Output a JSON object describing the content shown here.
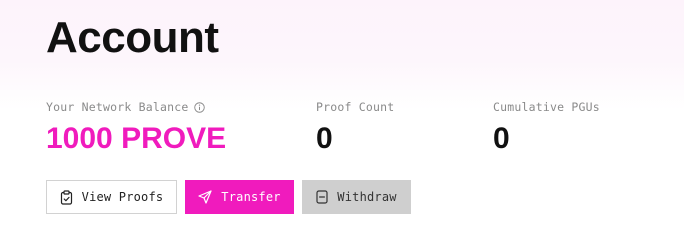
{
  "header": {
    "title": "Account"
  },
  "stats": {
    "network_balance": {
      "label": "Your Network Balance",
      "value": "1000 PROVE",
      "icon": "info-icon"
    },
    "proof_count": {
      "label": "Proof Count",
      "value": "0"
    },
    "cumulative_pgus": {
      "label": "Cumulative PGUs",
      "value": "0"
    }
  },
  "actions": {
    "view_proofs": {
      "label": "View Proofs",
      "icon": "clipboard-check-icon"
    },
    "transfer": {
      "label": "Transfer",
      "icon": "send-icon"
    },
    "withdraw": {
      "label": "Withdraw",
      "icon": "wallet-icon"
    }
  },
  "colors": {
    "accent": "#f01bbd",
    "disabled_bg": "#cfcfcf",
    "label_gray": "#8a8a8a"
  }
}
